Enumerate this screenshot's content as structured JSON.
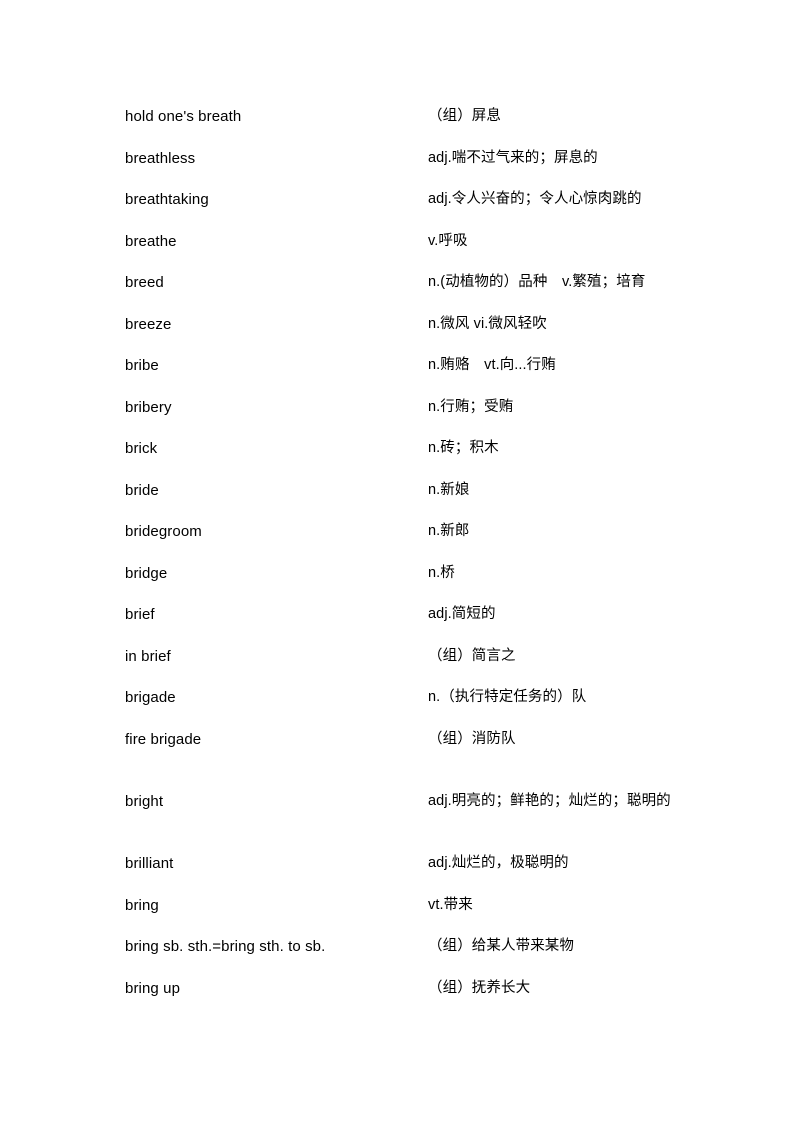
{
  "document": {
    "type": "vocabulary-list",
    "language_pair": "English-Chinese",
    "columns": {
      "term_header": "",
      "definition_header": ""
    },
    "entries": [
      {
        "term": "hold one's breath",
        "definition": "（组）屏息",
        "multiline": false
      },
      {
        "term": "breathless",
        "definition": "adj.喘不过气来的；屏息的",
        "multiline": false
      },
      {
        "term": "breathtaking",
        "definition": "adj.令人兴奋的；令人心惊肉跳的",
        "multiline": false
      },
      {
        "term": "breathe",
        "definition": "v.呼吸",
        "multiline": false
      },
      {
        "term": "breed",
        "definition": "n.(动植物的）品种　v.繁殖；培育",
        "multiline": false
      },
      {
        "term": "breeze",
        "definition": "n.微风 vi.微风轻吹",
        "multiline": false
      },
      {
        "term": "bribe",
        "definition": "n.贿赂　vt.向...行贿",
        "multiline": false
      },
      {
        "term": "bribery",
        "definition": "n.行贿；受贿",
        "multiline": false
      },
      {
        "term": "brick",
        "definition": "n.砖；积木",
        "multiline": false
      },
      {
        "term": "bride",
        "definition": "n.新娘",
        "multiline": false
      },
      {
        "term": "bridegroom",
        "definition": "n.新郎",
        "multiline": false
      },
      {
        "term": "bridge",
        "definition": "n.桥",
        "multiline": false
      },
      {
        "term": "brief",
        "definition": "adj.简短的",
        "multiline": false
      },
      {
        "term": "in brief",
        "definition": "（组）简言之",
        "multiline": false
      },
      {
        "term": "brigade",
        "definition": "n.（执行特定任务的）队",
        "multiline": false
      },
      {
        "term": "fire brigade",
        "definition": "（组）消防队",
        "multiline": false
      },
      {
        "term": "bright",
        "definition": "adj.明亮的；鲜艳的；灿烂的；聪明的",
        "multiline": true
      },
      {
        "term": "brilliant",
        "definition": "adj.灿烂的，极聪明的",
        "multiline": false
      },
      {
        "term": "bring",
        "definition": "vt.带来",
        "multiline": false
      },
      {
        "term": "bring sb. sth.=bring sth. to sb.",
        "definition": "（组）给某人带来某物",
        "multiline": false
      },
      {
        "term": "bring up",
        "definition": "（组）抚养长大",
        "multiline": false
      }
    ]
  }
}
